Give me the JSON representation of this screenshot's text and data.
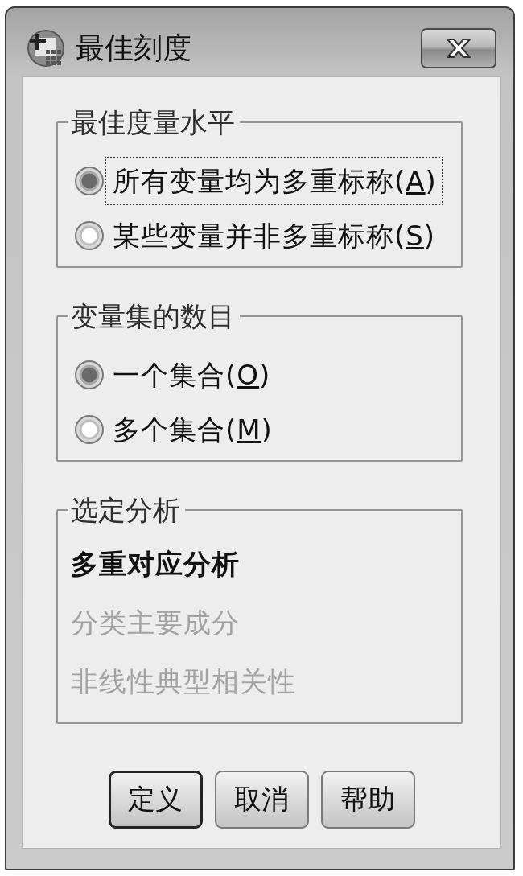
{
  "window": {
    "title": "最佳刻度"
  },
  "groups": [
    {
      "title": "最佳度量水平",
      "kind": "radio",
      "options": [
        {
          "before": "所有变量均为多重标称(",
          "access_key": "A",
          "after": ")",
          "selected": true,
          "focused": true
        },
        {
          "before": "某些变量并非多重标称(",
          "access_key": "S",
          "after": ")",
          "selected": false,
          "focused": false
        }
      ]
    },
    {
      "title": "变量集的数目",
      "kind": "radio",
      "options": [
        {
          "before": "一个集合(",
          "access_key": "O",
          "after": ")",
          "selected": true,
          "focused": false
        },
        {
          "before": "多个集合(",
          "access_key": "M",
          "after": ")",
          "selected": false,
          "focused": false
        }
      ]
    },
    {
      "title": "选定分析",
      "kind": "list",
      "items": [
        {
          "label": "多重对应分析",
          "enabled": true
        },
        {
          "label": "分类主要成分",
          "enabled": false
        },
        {
          "label": "非线性典型相关性",
          "enabled": false
        }
      ]
    }
  ],
  "buttons": [
    {
      "label": "定义",
      "default": true
    },
    {
      "label": "取消",
      "default": false
    },
    {
      "label": "帮助",
      "default": false
    }
  ]
}
